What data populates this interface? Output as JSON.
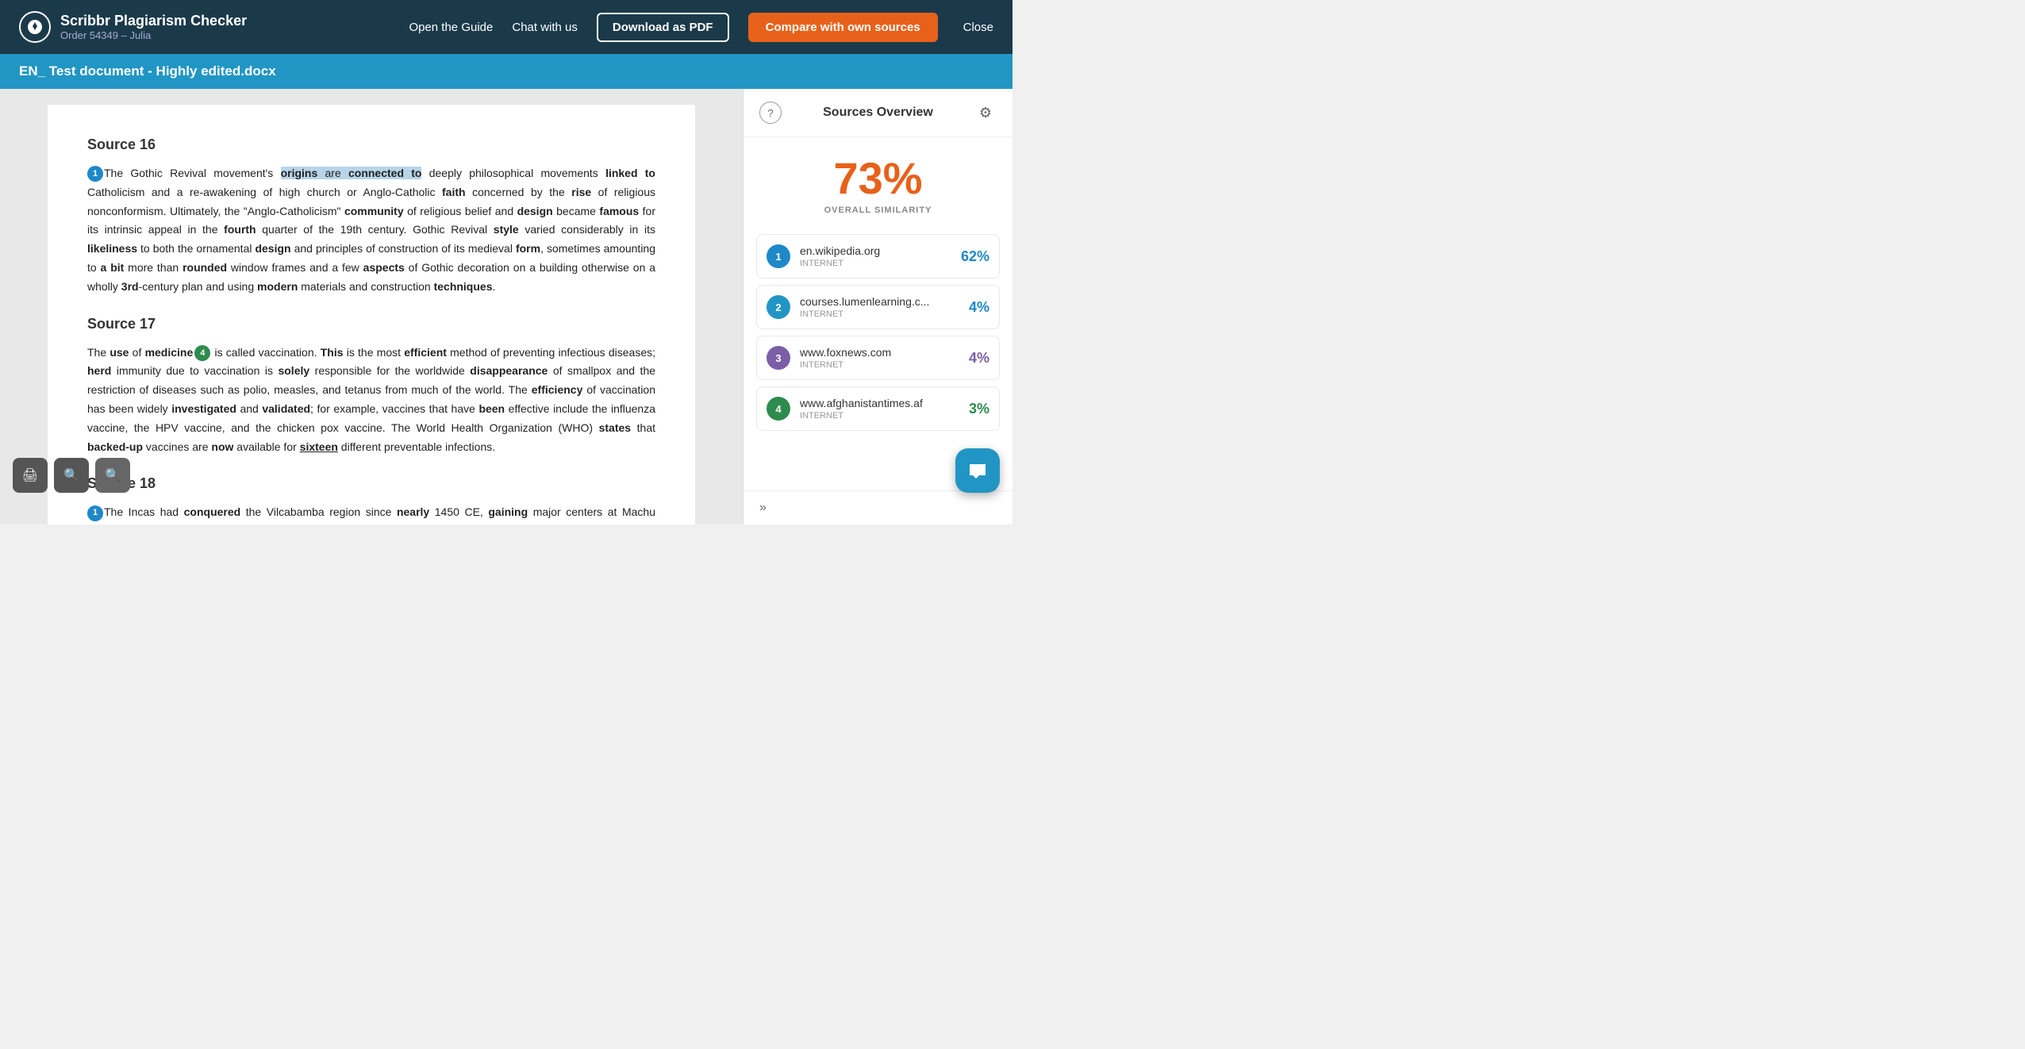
{
  "header": {
    "logo_title": "Scribbr Plagiarism Checker",
    "logo_subtitle": "Order 54349 – Julia",
    "nav_guide": "Open the Guide",
    "nav_chat": "Chat with us",
    "btn_download": "Download as PDF",
    "btn_compare": "Compare with own sources",
    "btn_close": "Close"
  },
  "file_bar": {
    "filename": "EN_ Test document - Highly edited.docx"
  },
  "sources_panel": {
    "title": "Sources Overview",
    "overall_similarity": "73%",
    "overall_label": "OVERALL SIMILARITY",
    "sources": [
      {
        "num": "1",
        "domain": "en.wikipedia.org",
        "type": "INTERNET",
        "percent": "62%",
        "color_class": "pct-blue",
        "num_class": "source-num-1"
      },
      {
        "num": "2",
        "domain": "courses.lumenlearning.c...",
        "type": "INTERNET",
        "percent": "4%",
        "color_class": "pct-blue",
        "num_class": "source-num-2"
      },
      {
        "num": "3",
        "domain": "www.foxnews.com",
        "type": "INTERNET",
        "percent": "4%",
        "color_class": "pct-purple",
        "num_class": "source-num-3"
      },
      {
        "num": "4",
        "domain": "www.afghanistantimes.af",
        "type": "INTERNET",
        "percent": "3%",
        "color_class": "pct-green",
        "num_class": "source-num-4"
      }
    ],
    "nav_arrow": "»"
  },
  "document": {
    "source16_heading": "Source 16",
    "source16_para": "The Gothic Revival movement's origins are connected to deeply philosophical movements linked to Catholicism and a re-awakening of high church or Anglo-Catholic faith concerned by the rise of religious nonconformism. Ultimately, the \"Anglo-Catholicism\" community of religious belief and design became famous for its intrinsic appeal in the fourth quarter of the 19th century. Gothic Revival style varied considerably in its likeliness to both the ornamental design and principles of construction of its medieval form, sometimes amounting to a bit more than rounded window frames and a few aspects of Gothic decoration on a building otherwise on a wholly 3rd-century plan and using modern materials and construction techniques.",
    "source17_heading": "Source 17",
    "source17_para": "The use of medicine is called vaccination. This is the most efficient method of preventing infectious diseases; herd immunity due to vaccination is solely responsible for the worldwide disappearance of smallpox and the restriction of diseases such as polio, measles, and tetanus from much of the world. The efficiency of vaccination has been widely investigated and validated; for example, vaccines that have been effective include the influenza vaccine, the HPV vaccine, and the chicken pox vaccine. The World Health Organization (WHO) states that backed-up vaccines are now available for sixteen different preventable infections.",
    "source18_heading": "Source 18",
    "source18_para": "The Incas had conquered the Vilcabamba region since nearly 1450 CE, gaining major centers at Machu Picchu, Choquequirao, Vitcos, or Vilcabamba. Thus, the people were familiar with the area when Inca leader, Manco Inca Yupanqui, won the Match of Ollantaytambo against the"
  }
}
